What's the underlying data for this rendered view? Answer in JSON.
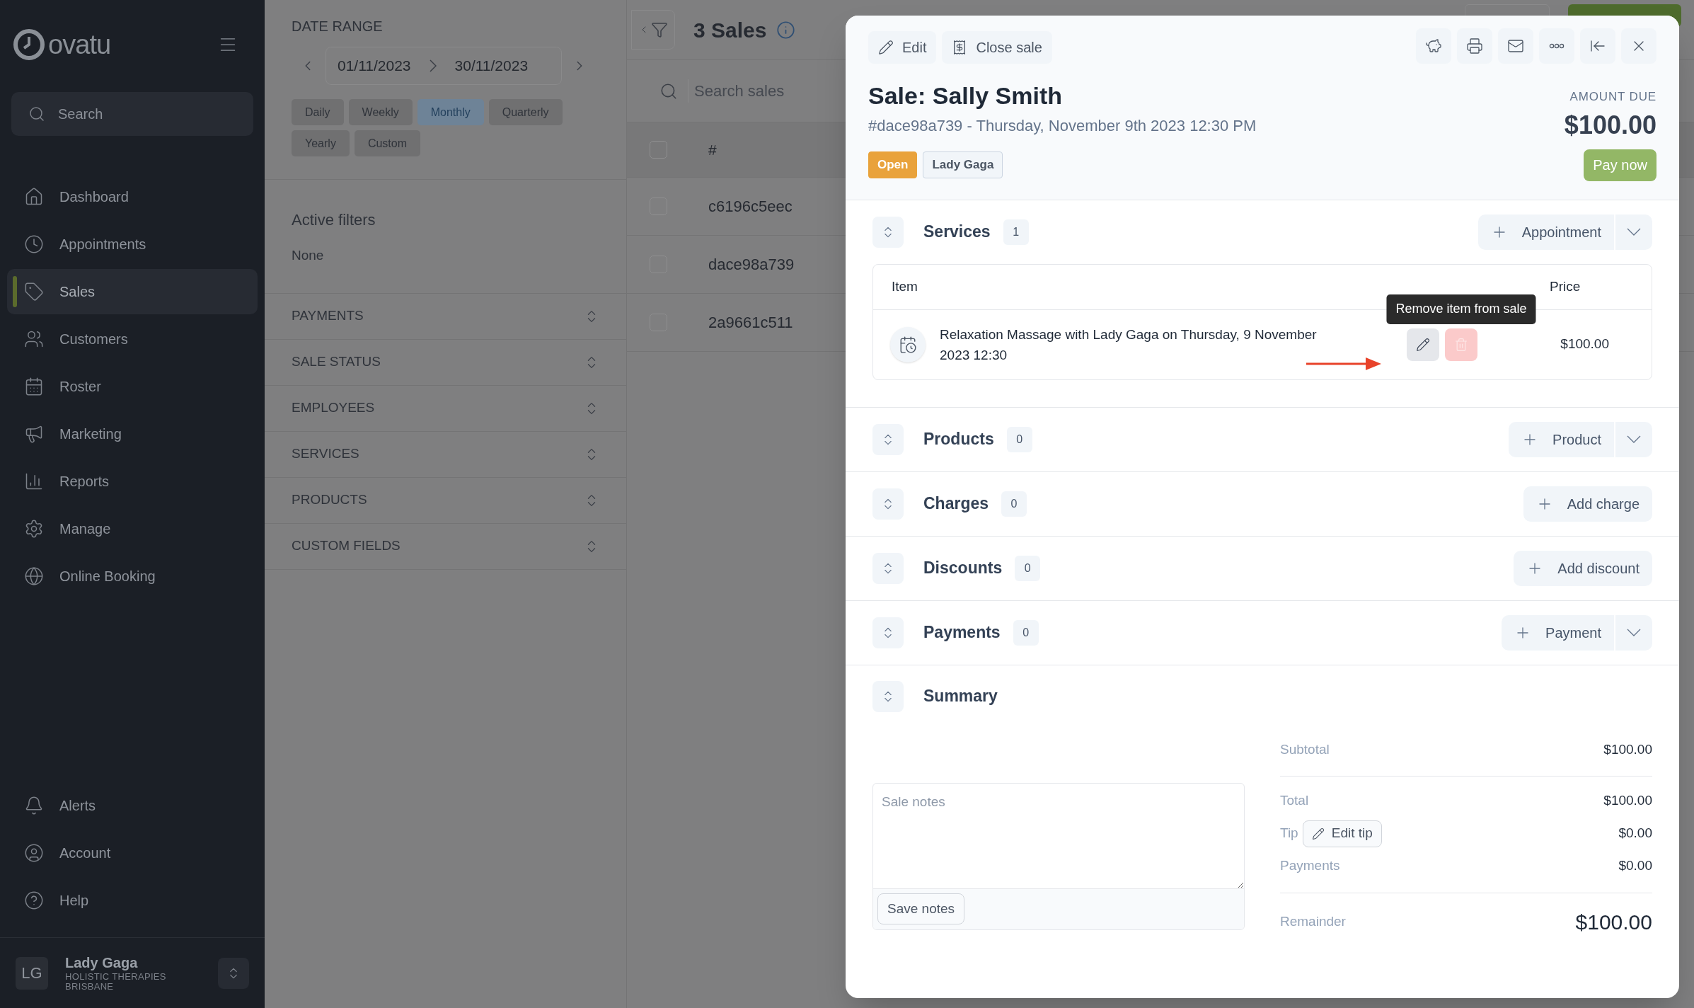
{
  "sidebar": {
    "logo": "ovatu",
    "search": {
      "placeholder": "Search"
    },
    "nav": [
      {
        "label": "Dashboard",
        "selected": false
      },
      {
        "label": "Appointments",
        "selected": false
      },
      {
        "label": "Sales",
        "selected": true
      },
      {
        "label": "Customers",
        "selected": false
      },
      {
        "label": "Roster",
        "selected": false
      },
      {
        "label": "Marketing",
        "selected": false
      },
      {
        "label": "Reports",
        "selected": false
      },
      {
        "label": "Manage",
        "selected": false
      },
      {
        "label": "Online Booking",
        "selected": false
      }
    ],
    "bottom_nav": [
      {
        "label": "Alerts"
      },
      {
        "label": "Account"
      },
      {
        "label": "Help"
      }
    ],
    "user": {
      "initials": "LG",
      "name": "Lady Gaga",
      "organisation": "HOLISTIC THERAPIES BRISBANE"
    }
  },
  "filters": {
    "date_range": {
      "title": "DATE RANGE",
      "start": "01/11/2023",
      "end": "30/11/2023"
    },
    "periods": [
      {
        "label": "Daily",
        "selected": false
      },
      {
        "label": "Weekly",
        "selected": false
      },
      {
        "label": "Monthly",
        "selected": true
      },
      {
        "label": "Quarterly",
        "selected": false
      },
      {
        "label": "Yearly",
        "selected": false
      },
      {
        "label": "Custom",
        "selected": false
      }
    ],
    "active_filters": {
      "title": "Active filters",
      "value": "None"
    },
    "sections": [
      "PAYMENTS",
      "SALE STATUS",
      "EMPLOYEES",
      "SERVICES",
      "PRODUCTS",
      "CUSTOM FIELDS"
    ]
  },
  "sales_list": {
    "title": "3 Sales",
    "search": {
      "placeholder": "Search sales"
    },
    "select_all": {
      "checked": false
    },
    "columns": [
      "#"
    ],
    "rows": [
      {
        "id": "c6196c5eec",
        "checked": false
      },
      {
        "id": "dace98a739",
        "checked": false
      },
      {
        "id": "2a9661c511",
        "checked": false
      }
    ]
  },
  "sale": {
    "toolbar": [
      "Edit",
      "Close sale"
    ],
    "title": "Sale: Sally Smith",
    "subtitle": "#dace98a739 - Thursday, November 9th 2023 12:30 PM",
    "tags": [
      {
        "label": "Open",
        "kind": "status"
      },
      {
        "label": "Lady Gaga",
        "kind": "staff"
      }
    ],
    "amount_due": {
      "label": "AMOUNT DUE",
      "value": "$100.00"
    },
    "pay_button": "Pay now",
    "sections": [
      {
        "title": "Services",
        "count": "1",
        "action": "Appointment",
        "dropdown": true,
        "table": {
          "columns": [
            "Item",
            "Price"
          ],
          "rows": [
            {
              "item": "Relaxation Massage with Lady Gaga on Thursday, 9 November 2023 12:30",
              "price": "$100.00"
            }
          ],
          "tooltip": "Remove item from sale"
        }
      },
      {
        "title": "Products",
        "count": "0",
        "action": "Product",
        "dropdown": true
      },
      {
        "title": "Charges",
        "count": "0",
        "action": "Add charge",
        "dropdown": false
      },
      {
        "title": "Discounts",
        "count": "0",
        "action": "Add discount",
        "dropdown": false
      },
      {
        "title": "Payments",
        "count": "0",
        "action": "Payment",
        "dropdown": true
      }
    ],
    "summary": {
      "title": "Summary",
      "notes": {
        "placeholder": "Sale notes",
        "button": "Save notes"
      },
      "subtotal": {
        "label": "Subtotal",
        "value": "$100.00"
      },
      "lines": [
        {
          "label": "Total",
          "value": "$100.00"
        },
        {
          "label": "Tip",
          "value": "$0.00",
          "button": "Edit tip"
        },
        {
          "label": "Payments",
          "value": "$0.00"
        }
      ],
      "remainder": {
        "label": "Remainder",
        "value": "$100.00"
      }
    }
  }
}
